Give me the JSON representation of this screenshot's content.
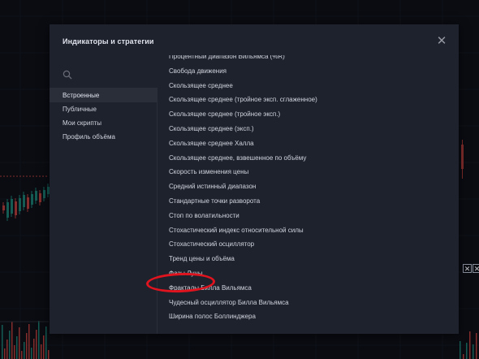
{
  "dialog": {
    "title": "Индикаторы и стратегии",
    "close_icon": "close-icon"
  },
  "search": {
    "icon": "search-icon",
    "placeholder": ""
  },
  "sidebar": {
    "items": [
      {
        "label": "Встроенные",
        "active": true
      },
      {
        "label": "Публичные",
        "active": false
      },
      {
        "label": "Мои скрипты",
        "active": false
      },
      {
        "label": "Профиль объёма",
        "active": false
      }
    ]
  },
  "indicators": [
    "Процентный диапазон Вильямса (%R)",
    "Свобода движения",
    "Скользящее среднее",
    "Скользящее среднее (тройное эксп. сглаженное)",
    "Скользящее среднее (тройное эксп.)",
    "Скользящее среднее (эксп.)",
    "Скользящее среднее Халла",
    "Скользящее среднее, взвешенное по объёму",
    "Скорость изменения цены",
    "Средний истинный диапазон",
    "Стандартные точки разворота",
    "Стоп по волатильности",
    "Стохастический индекс относительной силы",
    "Стохастический осциллятор",
    "Тренд цены и объёма",
    "Фазы Луны",
    "Фракталы Билла Вильямса",
    "Чудесный осциллятор Билла Вильямса",
    "Ширина полос Боллинджера"
  ],
  "colors": {
    "background": "#131722",
    "dialog": "#1e222d",
    "highlight": "#e0141e",
    "candle_up": "#26a69a",
    "candle_down": "#ef5350"
  },
  "corner_buttons": {
    "left": "✕",
    "right": "✕"
  }
}
